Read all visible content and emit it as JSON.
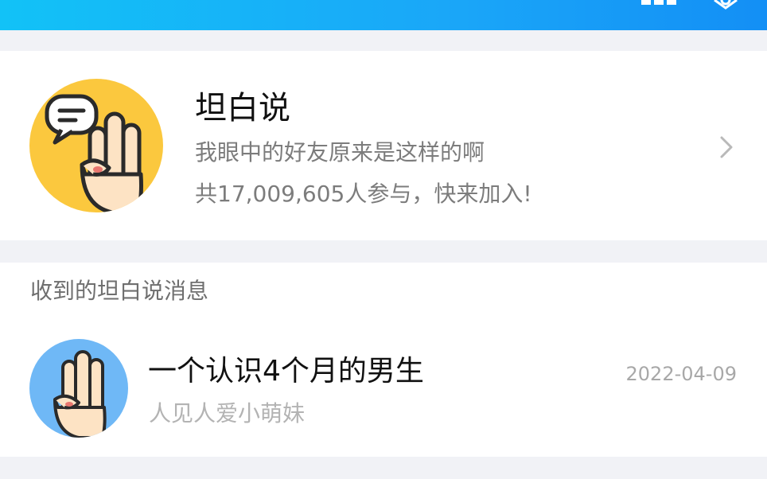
{
  "header": {
    "left_icon": "grid-icon",
    "right_icon": "settings-icon"
  },
  "feature": {
    "title": "坦白说",
    "subtitle": "我眼中的好友原来是这样的啊",
    "participants": "共17,009,605人参与，快来加入!",
    "avatar_icon": "hand-three-fingers-speech-bubble-icon",
    "accent": "#fbc83e"
  },
  "messages": {
    "section_label": "收到的坦白说消息",
    "items": [
      {
        "title": "一个认识4个月的男生",
        "subtitle": "人见人爱小萌妹",
        "date": "2022-04-09",
        "avatar_icon": "hand-three-fingers-icon",
        "accent": "#6fb8f6"
      }
    ]
  },
  "colors": {
    "header_start": "#12c2f7",
    "header_end": "#138ff5",
    "background": "#f1f2f6"
  }
}
